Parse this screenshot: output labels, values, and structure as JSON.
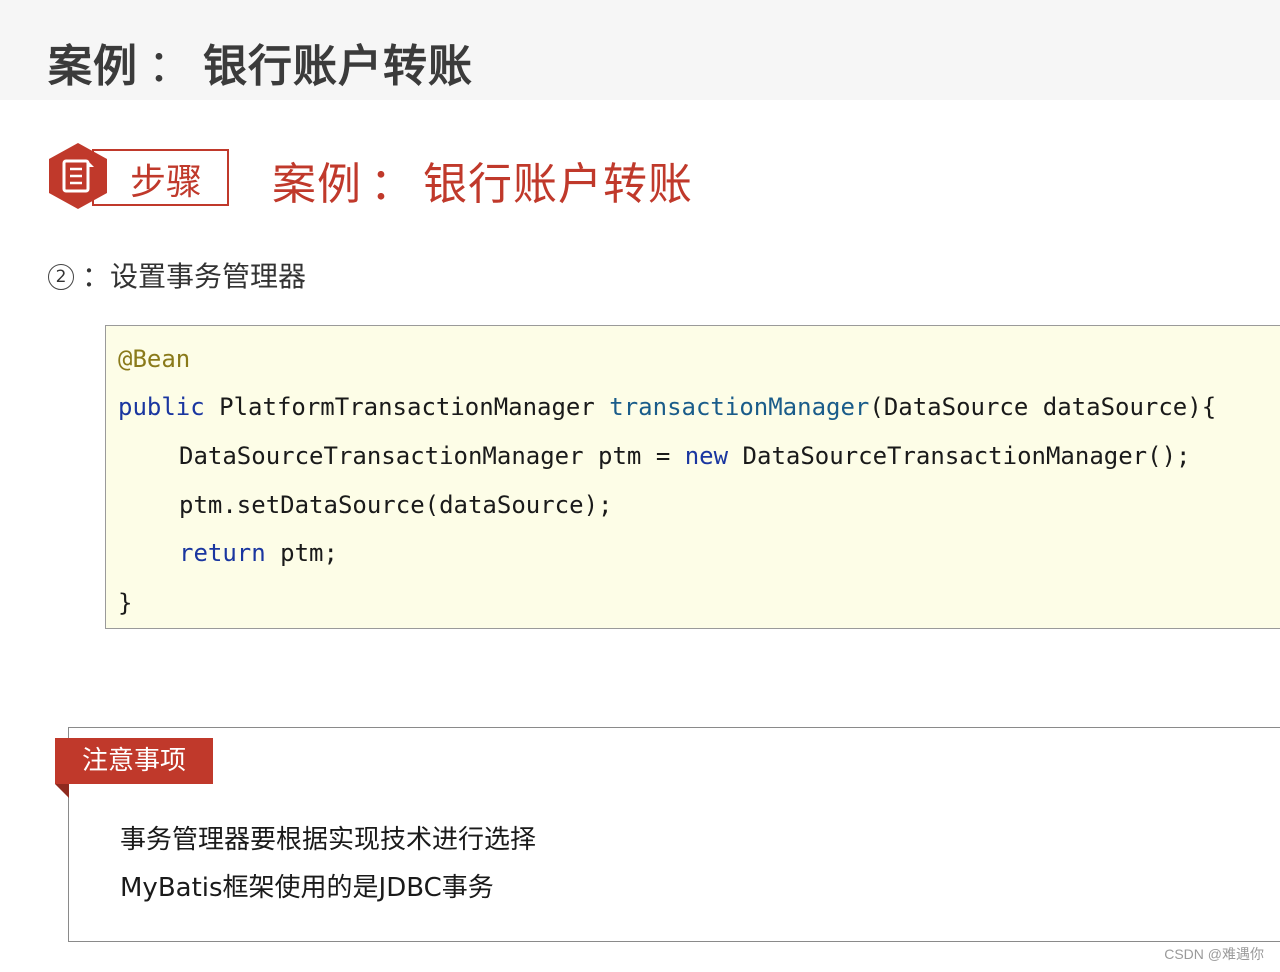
{
  "page": {
    "title_left": "案例",
    "title_sep": "：",
    "title_right": "银行账户转账"
  },
  "step": {
    "icon": "document-icon",
    "label": "步骤",
    "heading_left": "案例",
    "heading_sep": "：",
    "heading_right": "银行账户转账",
    "accent": "#c0392b"
  },
  "sub_point": {
    "number": "2",
    "sep": "：",
    "text": "设置事务管理器"
  },
  "code": {
    "background": "#fdfde7",
    "line1_annotation": "@Bean",
    "line2_kw": "public",
    "line2_type": " PlatformTransactionManager ",
    "line2_method": "transactionManager",
    "line2_rest": "(DataSource dataSource){",
    "line3_a": "DataSourceTransactionManager ptm = ",
    "line3_kw": "new",
    "line3_b": " DataSourceTransactionManager();",
    "line4": "ptm.setDataSource(dataSource);",
    "line5_kw": "return",
    "line5_rest": " ptm;",
    "line6": "}"
  },
  "notes": {
    "tag": "注意事项",
    "line1": "事务管理器要根据实现技术进行选择",
    "line2": "MyBatis框架使用的是JDBC事务"
  },
  "watermark": "CSDN @难遇你"
}
